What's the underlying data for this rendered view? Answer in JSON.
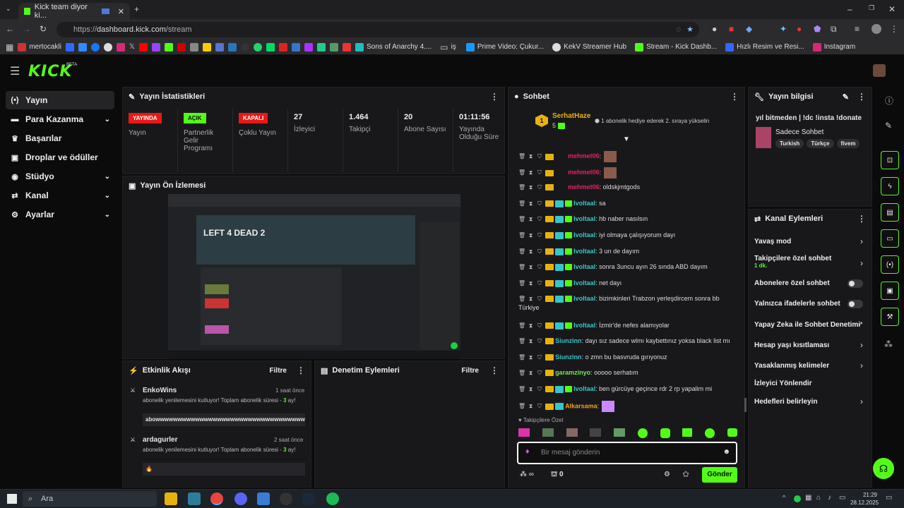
{
  "browser": {
    "tab_title": "Kick team diyor ki...",
    "url_prefix": "https://",
    "url_host": "dashboard.kick.com",
    "url_path": "/stream",
    "bookmarks": [
      "mertocakli",
      "Sons of Anarchy 4....",
      "iş",
      "Prime Video: Çukur...",
      "KekV Streamer Hub",
      "Stream - Kick Dashb...",
      "Hızlı Resim ve Resi...",
      "Instagram"
    ]
  },
  "sidebar": {
    "items": [
      {
        "label": "Yayın",
        "icon": "broadcast-icon"
      },
      {
        "label": "Para Kazanma",
        "icon": "money-icon"
      },
      {
        "label": "Başarılar",
        "icon": "trophy-icon"
      },
      {
        "label": "Droplar ve ödüller",
        "icon": "gift-icon"
      },
      {
        "label": "Stüdyo",
        "icon": "studio-icon"
      },
      {
        "label": "Kanal",
        "icon": "channel-icon"
      },
      {
        "label": "Ayarlar",
        "icon": "gear-icon"
      }
    ]
  },
  "stats": {
    "title": "Yayın İstatistikleri",
    "items": [
      {
        "badge": "YAYINDA",
        "label": "Yayın",
        "badge_color": "#e91916"
      },
      {
        "badge": "AÇIK",
        "label": "Partnerlik Gelir Programı",
        "badge_color": "#53fc18"
      },
      {
        "badge": "KAPALI",
        "label": "Çoklu Yayın",
        "badge_color": "#e91916"
      },
      {
        "value": "27",
        "label": "İzleyici"
      },
      {
        "value": "1.464",
        "label": "Takipçi"
      },
      {
        "value": "20",
        "label": "Abone Sayısı"
      },
      {
        "value": "01:11:56",
        "label": "Yayında Olduğu Süre"
      }
    ]
  },
  "preview": {
    "title": "Yayın Ön İzlemesi",
    "game_logo": "LEFT 4 DEAD 2"
  },
  "activity": {
    "title": "Etkinlik Akışı",
    "filter": "Filtre",
    "events": [
      {
        "user": "EnkoWins",
        "time": "1 saat önce",
        "text": "abonelik yenilemesini kutluyor! Toplam abonelik süresi - ",
        "months": "3",
        "unit": "ay!",
        "message": "abowwwwwwwwwwwwwwwwwwwwwwwwwwwwwwwwwwww"
      },
      {
        "user": "ardagurler",
        "time": "2 saat önce",
        "text": "abonelik yenilemesini kutluyor! Toplam abonelik süresi - ",
        "months": "3",
        "unit": "ay!",
        "message": "🔥"
      }
    ]
  },
  "moderation": {
    "title": "Denetim Eylemleri",
    "filter": "Filtre"
  },
  "chat": {
    "title": "Sohbet",
    "pinned_user": "SerhatHaze",
    "pinned_rank": "1",
    "pinned_count": "5",
    "gift_hint": "1 abonelik hediye ederek 2. sıraya yükselin",
    "messages": [
      {
        "user": "mehmet06",
        "text": "",
        "color": "#e0245e",
        "emote": true
      },
      {
        "user": "mehmet06",
        "text": "",
        "color": "#e0245e",
        "emote": true
      },
      {
        "user": "mehmet06",
        "text": " oldskjmtgods",
        "color": "#e0245e"
      },
      {
        "user": "Ivoltaal",
        "text": " sa",
        "color": "#36c5c8"
      },
      {
        "user": "Ivoltaal",
        "text": " hb naber nasılsın",
        "color": "#36c5c8"
      },
      {
        "user": "Ivoltaal",
        "text": " iyi olmaya çalışıyorum dayı",
        "color": "#36c5c8"
      },
      {
        "user": "Ivoltaal",
        "text": " 3 un de dayım",
        "color": "#36c5c8"
      },
      {
        "user": "Ivoltaal",
        "text": " sonra 3uncu ayın 26 sında ABD dayım",
        "color": "#36c5c8"
      },
      {
        "user": "Ivoltaal",
        "text": " net dayı",
        "color": "#36c5c8"
      },
      {
        "user": "Ivoltaal",
        "text": " bizimkinleri Trabzon yerleşdircem sonra bb",
        "cont": "Türkiye",
        "color": "#36c5c8"
      },
      {
        "user": "Ivoltaal",
        "text": " İzmir'de nefes alamıyolar",
        "color": "#36c5c8"
      },
      {
        "user": "Siunzinn",
        "text": " dayı sız sadece wlmı kaybettınız yoksa black list mı",
        "color": "#36c5c8"
      },
      {
        "user": "Siunzinn",
        "text": " o zmn bu basvruda gırıyonuz",
        "color": "#36c5c8"
      },
      {
        "user": "garamzinyo",
        "text": " ooooo serhatım",
        "color": "#7be35a"
      },
      {
        "user": "Ivoltaal",
        "text": " ben gürcüye geçince rdr 2 rp yapalim mi",
        "color": "#36c5c8"
      },
      {
        "user": "Alkarsama",
        "text": "",
        "color": "#f0a020",
        "emote": true
      }
    ],
    "followers_only": "Takipçilere Özel",
    "input_placeholder": "Bir mesaj gönderin",
    "points": "0",
    "send": "Gönder"
  },
  "stream_info": {
    "title": "Yayın bilgisi",
    "stream_title": "yıl bitmeden | !dc !insta !donate",
    "category": "Sadece Sohbet",
    "tags": [
      "Turkish",
      "Türkçe",
      "fivem"
    ]
  },
  "channel_actions": {
    "title": "Kanal Eylemleri",
    "items": [
      {
        "label": "Yavaş mod",
        "type": "arrow"
      },
      {
        "label": "Takipçilere özel sohbet",
        "sub": "1 dk.",
        "type": "arrow"
      },
      {
        "label": "Abonelere özel sohbet",
        "type": "toggle"
      },
      {
        "label": "Yalnızca ifadelerle sohbet",
        "type": "toggle"
      },
      {
        "label": "Yapay Zeka ile Sohbet Denetimi",
        "type": "link"
      },
      {
        "label": "Hesap yaşı kısıtlaması",
        "type": "arrow"
      },
      {
        "label": "Yasaklanmış kelimeler",
        "type": "arrow"
      },
      {
        "label": "İzleyici Yönlendir",
        "type": "none"
      },
      {
        "label": "Hedefleri belirleyin",
        "type": "arrow"
      }
    ]
  },
  "taskbar": {
    "search": "Ara",
    "time": "21:29",
    "date": "28.12.2025"
  },
  "colors": {
    "accent": "#53fc18",
    "live": "#e91916",
    "panel": "#18181b"
  }
}
